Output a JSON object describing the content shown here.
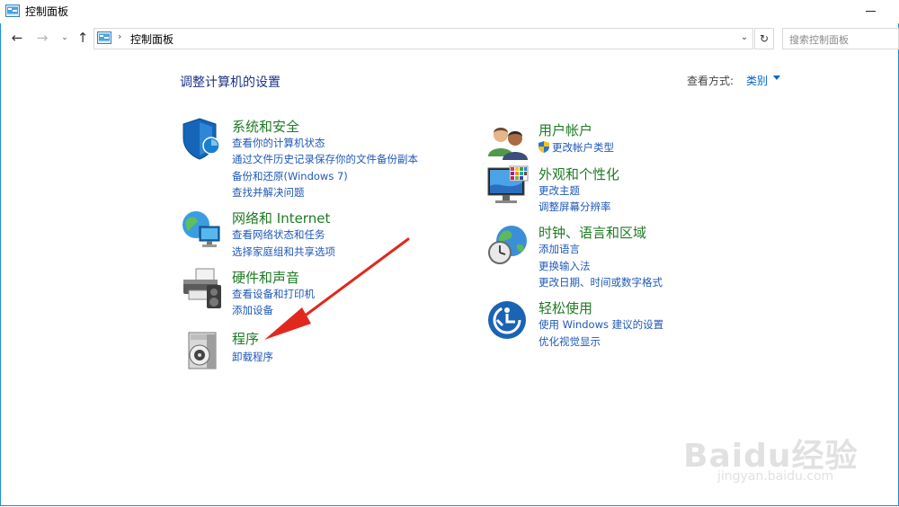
{
  "window": {
    "title": "控制面板"
  },
  "nav": {
    "address_text": "控制面板",
    "search_placeholder": "搜索控制面板"
  },
  "main": {
    "heading": "调整计算机的设置",
    "view_by_label": "查看方式:",
    "view_by_value": "类别"
  },
  "categories": [
    {
      "icon": "shield-security-icon",
      "title": "系统和安全",
      "links": [
        "查看你的计算机状态",
        "通过文件历史记录保存你的文件备份副本",
        "备份和还原(Windows 7)",
        "查找并解决问题"
      ]
    },
    {
      "icon": "network-globe-icon",
      "title": "网络和 Internet",
      "links": [
        "查看网络状态和任务",
        "选择家庭组和共享选项"
      ]
    },
    {
      "icon": "printer-hardware-icon",
      "title": "硬件和声音",
      "links": [
        "查看设备和打印机",
        "添加设备"
      ]
    },
    {
      "icon": "program-disc-icon",
      "title": "程序",
      "links": [
        "卸载程序"
      ]
    },
    {
      "icon": "users-icon",
      "title": "用户帐户",
      "links": [
        "更改帐户类型"
      ]
    },
    {
      "icon": "monitor-appearance-icon",
      "title": "外观和个性化",
      "links": [
        "更改主题",
        "调整屏幕分辨率"
      ]
    },
    {
      "icon": "clock-globe-icon",
      "title": "时钟、语言和区域",
      "links": [
        "添加语言",
        "更换输入法",
        "更改日期、时间或数字格式"
      ]
    },
    {
      "icon": "ease-of-access-icon",
      "title": "轻松使用",
      "links": [
        "使用 Windows 建议的设置",
        "优化视觉显示"
      ]
    }
  ],
  "watermark": {
    "brand": "Baidu经验",
    "url": "jingyan.baidu.com"
  },
  "colors": {
    "title_green": "#1f7a24",
    "link_blue": "#1f59b8",
    "heading_navy": "#1e3287",
    "annotation_red": "#e0281e"
  }
}
